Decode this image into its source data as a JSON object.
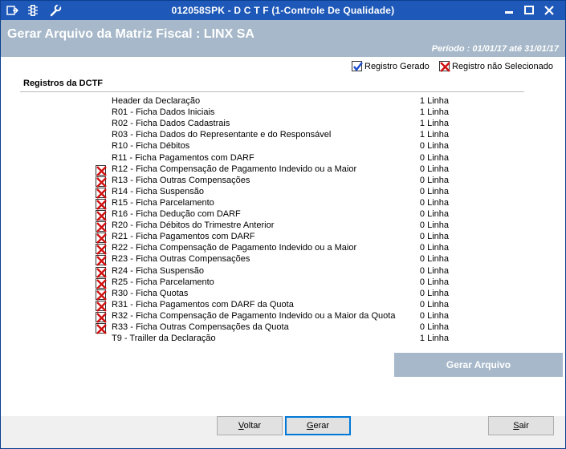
{
  "titlebar": {
    "title": "012058SPK - D C T F (1-Controle De Qualidade)",
    "icons": [
      "window-menu-icon",
      "traffic-light-icon",
      "wrench-icon"
    ],
    "minimize": "▬",
    "maximize": "□",
    "close": "✕"
  },
  "header": {
    "title": "Gerar Arquivo da Matriz Fiscal : LINX SA",
    "period": "Período : 01/01/17 até 31/01/17"
  },
  "legend": {
    "generated": "Registro Gerado",
    "not_selected": "Registro não Selecionado"
  },
  "section": {
    "title": "Registros da DCTF"
  },
  "records": [
    {
      "label": "Header da Declaração",
      "count": "1 Linha",
      "status": "none"
    },
    {
      "label": "R01 - Ficha Dados Iniciais",
      "count": "1 Linha",
      "status": "none"
    },
    {
      "label": "R02 - Ficha Dados Cadastrais",
      "count": "1 Linha",
      "status": "none"
    },
    {
      "label": "R03 - Ficha Dados do Representante e do Responsável",
      "count": "1 Linha",
      "status": "none"
    },
    {
      "label": "R10 - Ficha Débitos",
      "count": "0 Linha",
      "status": "none"
    },
    {
      "label": "R11 - Ficha Pagamentos com DARF",
      "count": "0 Linha",
      "status": "none"
    },
    {
      "label": "R12 - Ficha Compensação de Pagamento Indevido ou a Maior",
      "count": "0 Linha",
      "status": "not_selected"
    },
    {
      "label": "R13 - Ficha Outras Compensações",
      "count": "0 Linha",
      "status": "not_selected"
    },
    {
      "label": "R14 - Ficha Suspensão",
      "count": "0 Linha",
      "status": "not_selected"
    },
    {
      "label": "R15 - Ficha Parcelamento",
      "count": "0 Linha",
      "status": "not_selected"
    },
    {
      "label": "R16 - Ficha Dedução com DARF",
      "count": "0 Linha",
      "status": "not_selected"
    },
    {
      "label": "R20 - Ficha Débitos do Trimestre Anterior",
      "count": "0 Linha",
      "status": "not_selected"
    },
    {
      "label": "R21 - Ficha Pagamentos com DARF",
      "count": "0 Linha",
      "status": "not_selected"
    },
    {
      "label": "R22 - Ficha Compensação de Pagamento Indevido ou a Maior",
      "count": "0 Linha",
      "status": "not_selected"
    },
    {
      "label": "R23 - Ficha Outras Compensações",
      "count": "0 Linha",
      "status": "not_selected"
    },
    {
      "label": "R24 - Ficha Suspensão",
      "count": "0 Linha",
      "status": "not_selected"
    },
    {
      "label": "R25 - Ficha Parcelamento",
      "count": "0 Linha",
      "status": "not_selected"
    },
    {
      "label": "R30 - Ficha Quotas",
      "count": "0 Linha",
      "status": "not_selected"
    },
    {
      "label": "R31 - Ficha Pagamentos com DARF da Quota",
      "count": "0 Linha",
      "status": "not_selected"
    },
    {
      "label": "R32 - Ficha Compensação de Pagamento Indevido ou a Maior da Quota",
      "count": "0 Linha",
      "status": "not_selected"
    },
    {
      "label": "R33 - Ficha Outras Compensações da Quota",
      "count": "0 Linha",
      "status": "not_selected"
    },
    {
      "label": "T9 - Trailler da Declaração",
      "count": "1 Linha",
      "status": "none"
    }
  ],
  "actions": {
    "generate_file": "Gerar Arquivo",
    "back": "Voltar",
    "back_key": "V",
    "back_rest": "oltar",
    "generate": "Gerar",
    "generate_key": "G",
    "generate_rest": "erar",
    "exit": "Sair",
    "exit_key": "S",
    "exit_rest": "air"
  },
  "colors": {
    "titlebar": "#1e58b8",
    "header_band": "#a6b8c9",
    "check_blue": "#1f4fd1",
    "cross_red": "#d01010"
  }
}
